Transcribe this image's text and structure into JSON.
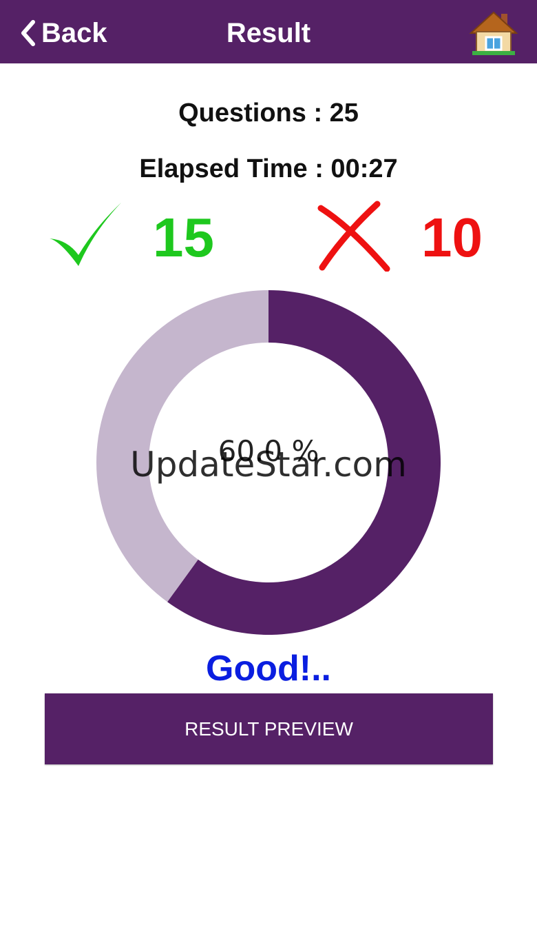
{
  "header": {
    "back_label": "Back",
    "title": "Result",
    "back_icon": "chevron-left-icon",
    "home_icon": "house-icon",
    "background_color": "#552166"
  },
  "summary": {
    "questions_text": "Questions : 25",
    "elapsed_text": "Elapsed Time : 00:27",
    "correct_count": "15",
    "wrong_count": "10",
    "correct_icon": "checkmark-icon",
    "wrong_icon": "cross-icon",
    "correct_color": "#1ec81e",
    "wrong_color": "#ee1111"
  },
  "chart_data": {
    "type": "pie",
    "series": [
      {
        "name": "Correct",
        "value": 60,
        "color": "#552166"
      },
      {
        "name": "Wrong",
        "value": 40,
        "color": "#c5b6cd"
      }
    ],
    "center_label": "60.0 %"
  },
  "verdict": "Good!..",
  "preview_button": "RESULT PREVIEW",
  "watermark": "UpdateStar.com"
}
